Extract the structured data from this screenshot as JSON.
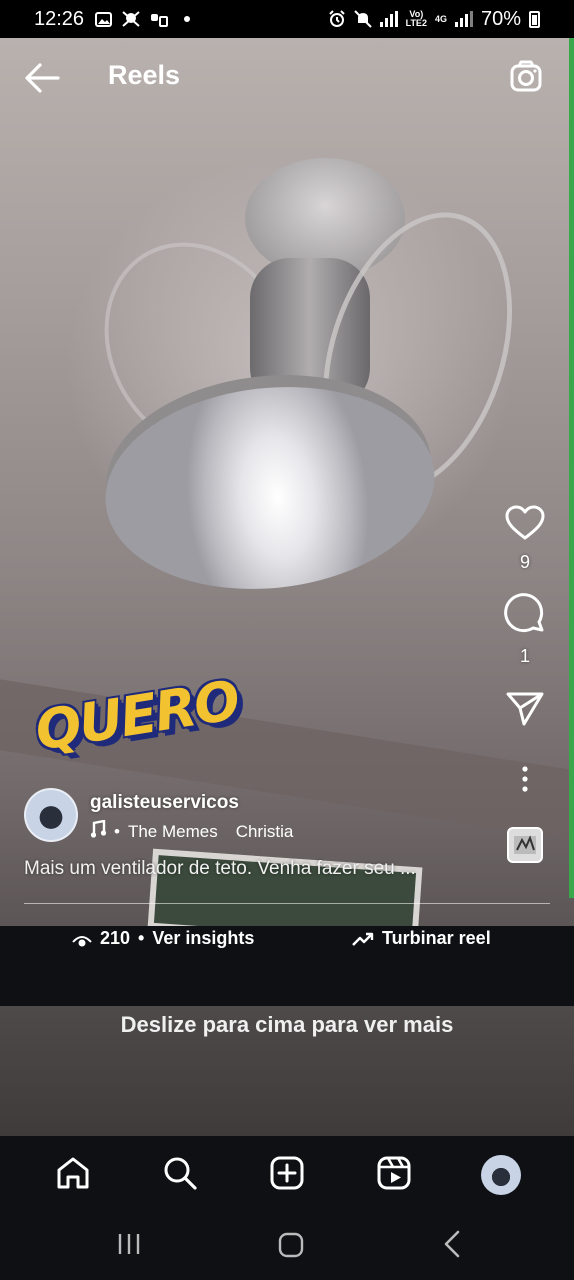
{
  "status_bar": {
    "time": "12:26",
    "battery": "70%",
    "network_top": "Vo)",
    "network_bottom": "LTE2",
    "gen_label": "4G"
  },
  "header": {
    "title": "Reels"
  },
  "rail": {
    "likes": "9",
    "comments": "1"
  },
  "sticker": {
    "text": "QUERO"
  },
  "post": {
    "username": "galisteuservicos",
    "audio_separator": "•",
    "audio_name": "The Memes",
    "audio_artist": "Christia",
    "caption": "Mais um ventilador de teto. Venha fazer seu ..."
  },
  "insights": {
    "views": "210",
    "separator": "•",
    "insights_label": "Ver insights",
    "boost_label": "Turbinar reel"
  },
  "swipe_hint": "Deslize para cima para ver mais"
}
